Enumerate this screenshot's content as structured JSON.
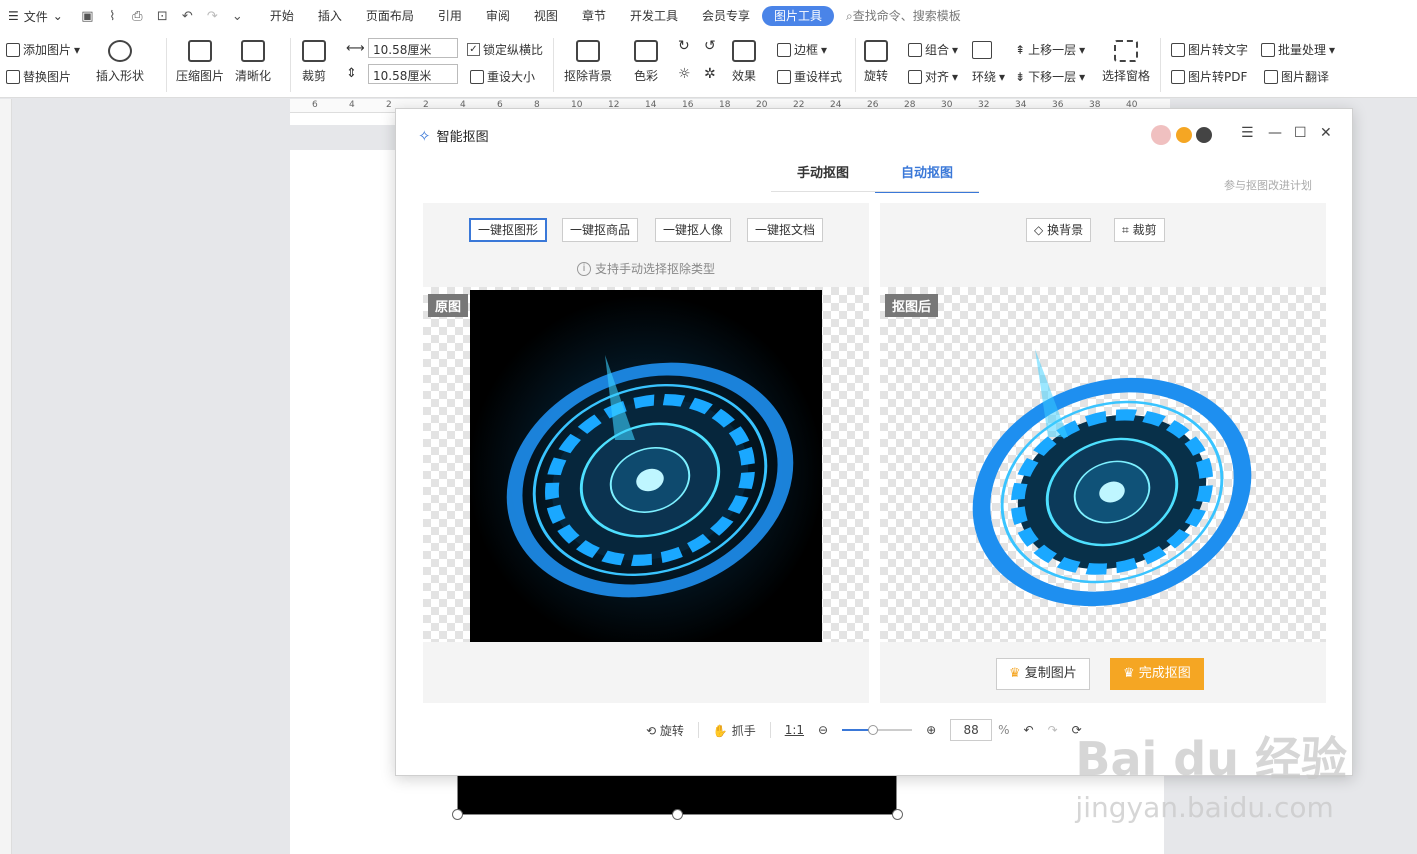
{
  "menu": {
    "file_label": "文件",
    "tabs": [
      "开始",
      "插入",
      "页面布局",
      "引用",
      "审阅",
      "视图",
      "章节",
      "开发工具",
      "会员专享"
    ],
    "active_tab": "图片工具",
    "search_placeholder": "查找命令、搜索模板"
  },
  "ribbon": {
    "add_image": "添加图片",
    "replace_image": "替换图片",
    "insert_shape": "插入形状",
    "compress_image": "压缩图片",
    "clarify": "清晰化",
    "crop": "裁剪",
    "width_value": "10.58厘米",
    "height_value": "10.58厘米",
    "lock_ratio": "锁定纵横比",
    "reset_size": "重设大小",
    "remove_bg": "抠除背景",
    "color": "色彩",
    "effects": "效果",
    "border": "边框",
    "reset_style": "重设样式",
    "rotate": "旋转",
    "group": "组合",
    "align": "对齐",
    "wrap": "环绕",
    "bring_forward": "上移一层",
    "send_backward": "下移一层",
    "selection_pane": "选择窗格",
    "image_to_text": "图片转文字",
    "image_to_pdf": "图片转PDF",
    "batch": "批量处理",
    "translate": "图片翻译"
  },
  "ruler": [
    "6",
    "4",
    "2",
    "2",
    "4",
    "6",
    "8",
    "10",
    "12",
    "14",
    "16",
    "18",
    "20",
    "22",
    "24",
    "26",
    "28",
    "30",
    "32",
    "34",
    "36",
    "38",
    "40"
  ],
  "dialog": {
    "title": "智能抠图",
    "tab_manual": "手动抠图",
    "tab_auto": "自动抠图",
    "feedback": "参与抠图改进计划",
    "options": [
      "一键抠图形",
      "一键抠商品",
      "一键抠人像",
      "一键抠文档"
    ],
    "hint": "支持手动选择抠除类型",
    "original_label": "原图",
    "result_label": "抠图后",
    "change_bg": "换背景",
    "crop": "裁剪",
    "copy_image": "复制图片",
    "finish": "完成抠图",
    "rotate": "旋转",
    "hand": "抓手",
    "one_to_one": "1:1",
    "zoom": "88",
    "percent": "%"
  },
  "watermark": {
    "brand": "Bai du 经验",
    "url": "jingyan.baidu.com"
  },
  "colors": {
    "accent": "#3a78d8",
    "primary_btn": "#f5a623",
    "active_tab": "#4a84e8"
  },
  "zoom_level": 0.44
}
